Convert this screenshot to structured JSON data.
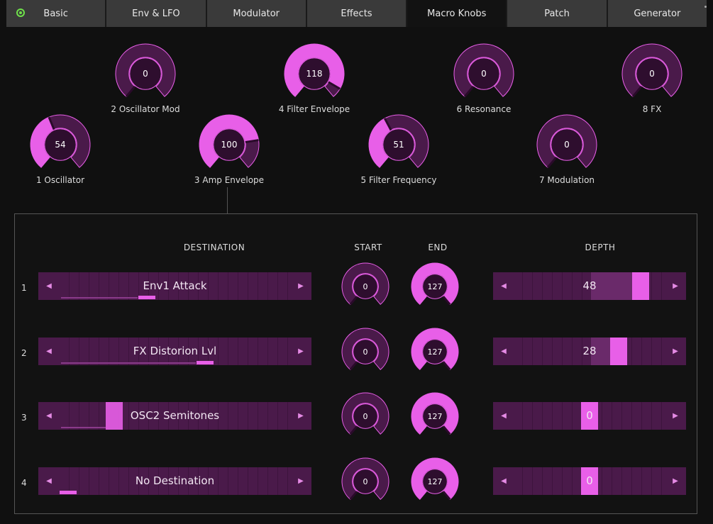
{
  "tabs": [
    {
      "label": "Basic"
    },
    {
      "label": "Env & LFO"
    },
    {
      "label": "Modulator"
    },
    {
      "label": "Effects"
    },
    {
      "label": "Macro Knobs"
    },
    {
      "label": "Patch"
    },
    {
      "label": "Generator"
    }
  ],
  "macros": [
    {
      "label": "1 Oscillator",
      "value": "54",
      "level": 0.42
    },
    {
      "label": "2 Oscillator Mod",
      "value": "0",
      "level": 0
    },
    {
      "label": "3 Amp Envelope",
      "value": "100",
      "level": 0.79
    },
    {
      "label": "4 Filter Envelope",
      "value": "118",
      "level": 0.93
    },
    {
      "label": "5 Filter Frequency",
      "value": "51",
      "level": 0.4
    },
    {
      "label": "6 Resonance",
      "value": "0",
      "level": 0
    },
    {
      "label": "7 Modulation",
      "value": "0",
      "level": 0
    },
    {
      "label": "8 FX",
      "value": "0",
      "level": 0
    }
  ],
  "panel": {
    "headers": {
      "destination": "DESTINATION",
      "start": "START",
      "end": "END",
      "depth": "DEPTH"
    },
    "rows": [
      {
        "num": "1",
        "destination": "Env1 Attack",
        "start": "0",
        "end": "127",
        "depth": "48"
      },
      {
        "num": "2",
        "destination": "FX Distorion Lvl",
        "start": "0",
        "end": "127",
        "depth": "28"
      },
      {
        "num": "3",
        "destination": "OSC2 Semitones",
        "start": "0",
        "end": "127",
        "depth": "0"
      },
      {
        "num": "4",
        "destination": "No Destination",
        "start": "0",
        "end": "127",
        "depth": "0"
      }
    ]
  },
  "colors": {
    "accent": "#e85fe8",
    "track": "#4a1a4a",
    "power": "#6ee04a"
  },
  "icons": {
    "power": "power-indicator-icon",
    "left": "arrow-left-icon",
    "right": "arrow-right-icon"
  }
}
